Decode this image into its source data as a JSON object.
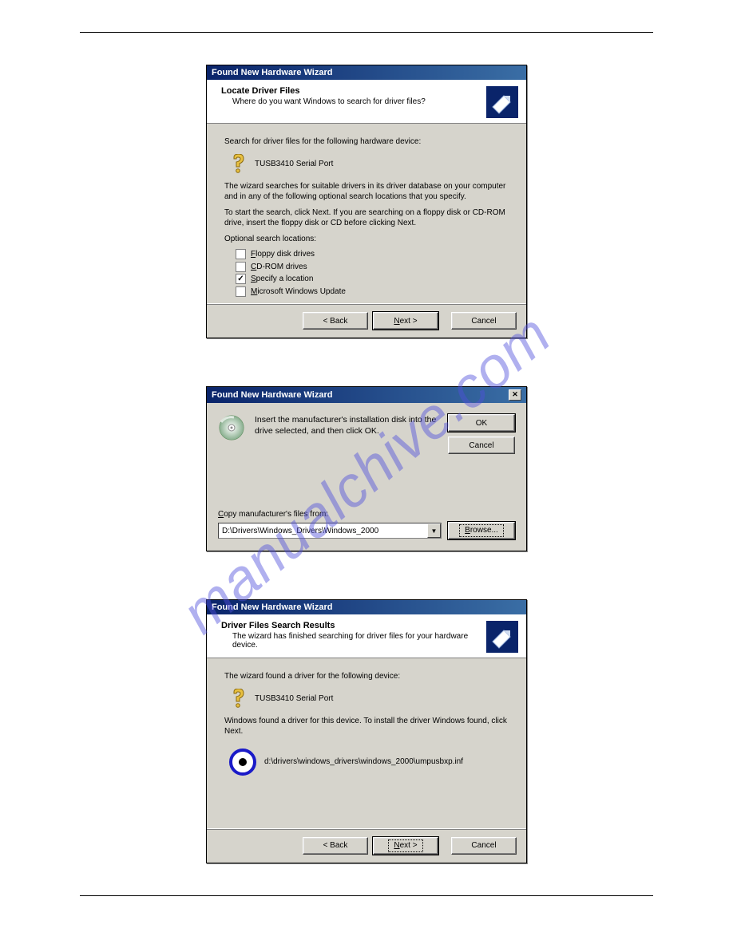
{
  "watermark": "manualchive.com",
  "dialog1": {
    "title": "Found New Hardware Wizard",
    "header_title": "Locate Driver Files",
    "header_sub": "Where do you want Windows to search for driver files?",
    "line_search": "Search for driver files for the following hardware device:",
    "device": "TUSB3410 Serial Port",
    "para1": "The wizard searches for suitable drivers in its driver database on your computer and in any of the following optional search locations that you specify.",
    "para2": "To start the search, click Next. If you are searching on a floppy disk or CD-ROM drive, insert the floppy disk or CD before clicking Next.",
    "opts_label": "Optional search locations:",
    "opts": [
      {
        "label_pre": "F",
        "label": "loppy disk drives",
        "checked": false
      },
      {
        "label_pre": "C",
        "label": "D-ROM drives",
        "checked": false
      },
      {
        "label_pre": "S",
        "label": "pecify a location",
        "checked": true
      },
      {
        "label_pre": "M",
        "label": "icrosoft Windows Update",
        "checked": false
      }
    ],
    "btn_back": "< Back",
    "btn_next": "Next >",
    "btn_cancel": "Cancel"
  },
  "dialog2": {
    "title": "Found New Hardware Wizard",
    "msg": "Insert the manufacturer's installation disk into the drive selected, and then click OK.",
    "btn_ok": "OK",
    "btn_cancel": "Cancel",
    "copy_label_pre": "C",
    "copy_label": "opy manufacturer's files from:",
    "path": "D:\\Drivers\\Windows_Drivers\\Windows_2000",
    "btn_browse": "Browse..."
  },
  "dialog3": {
    "title": "Found New Hardware Wizard",
    "header_title": "Driver Files Search Results",
    "header_sub": "The wizard has finished searching for driver files for your hardware device.",
    "line_found": "The wizard found a driver for the following device:",
    "device": "TUSB3410 Serial Port",
    "para_found": "Windows found a driver for this device. To install the driver Windows found, click Next.",
    "inf_path": "d:\\drivers\\windows_drivers\\windows_2000\\umpusbxp.inf",
    "btn_back": "< Back",
    "btn_next": "Next >",
    "btn_cancel": "Cancel"
  }
}
